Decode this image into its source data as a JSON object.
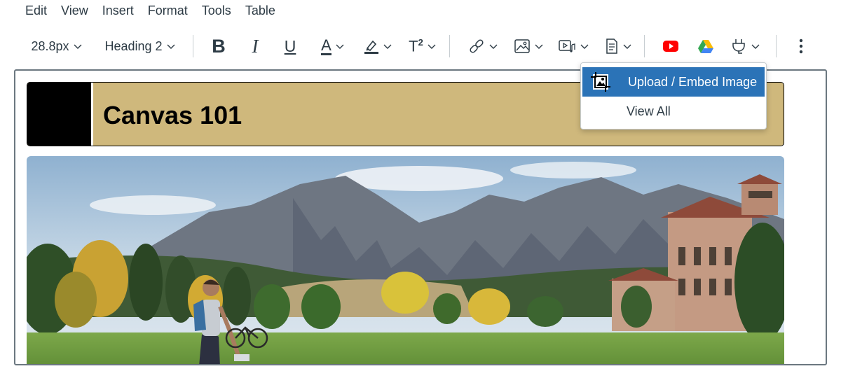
{
  "menubar": {
    "items": [
      "Edit",
      "View",
      "Insert",
      "Format",
      "Tools",
      "Table"
    ]
  },
  "toolbar": {
    "font_size": "28.8px",
    "block_format": "Heading 2",
    "bold_glyph": "B",
    "italic_glyph": "I",
    "underline_glyph": "U",
    "text_color_glyph": "A",
    "superscript_glyph": "T",
    "superscript_mark": "2",
    "icons": [
      "chevron-down-icon",
      "link-icon",
      "image-icon",
      "media-icon",
      "document-icon",
      "youtube-icon",
      "google-drive-icon",
      "plug-icon",
      "more-options-icon"
    ]
  },
  "editor": {
    "banner_title": "Canvas 101"
  },
  "image_menu": {
    "items": [
      {
        "label": "Upload / Embed Image",
        "active": true
      },
      {
        "label": "View All",
        "active": false
      }
    ]
  },
  "colors": {
    "banner_gold": "#cfb87c",
    "banner_black": "#000000",
    "menu_highlight": "#2b73b7",
    "youtube_red": "#ff0000",
    "text": "#2d3b45"
  }
}
